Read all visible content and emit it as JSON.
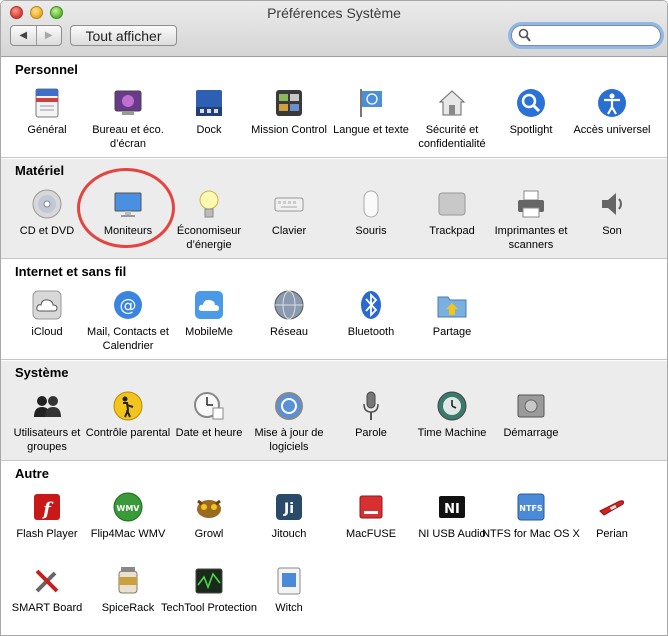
{
  "window": {
    "title": "Préférences Système"
  },
  "toolbar": {
    "back_label": "◀",
    "forward_label": "▶",
    "show_all_label": "Tout afficher",
    "search_value": "",
    "search_placeholder": ""
  },
  "sections": [
    {
      "title": "Personnel",
      "items": [
        {
          "label": "Général",
          "icon": "general-icon"
        },
        {
          "label": "Bureau et éco. d’écran",
          "icon": "desktop-screensaver-icon"
        },
        {
          "label": "Dock",
          "icon": "dock-icon"
        },
        {
          "label": "Mission Control",
          "icon": "mission-control-icon"
        },
        {
          "label": "Langue et texte",
          "icon": "language-text-icon"
        },
        {
          "label": "Sécurité et confidentialité",
          "icon": "security-icon"
        },
        {
          "label": "Spotlight",
          "icon": "spotlight-icon"
        },
        {
          "label": "Accès universel",
          "icon": "universal-access-icon"
        }
      ]
    },
    {
      "title": "Matériel",
      "items": [
        {
          "label": "CD et DVD",
          "icon": "cd-dvd-icon"
        },
        {
          "label": "Moniteurs",
          "icon": "displays-icon"
        },
        {
          "label": "Économiseur d’énergie",
          "icon": "energy-saver-icon"
        },
        {
          "label": "Clavier",
          "icon": "keyboard-icon"
        },
        {
          "label": "Souris",
          "icon": "mouse-icon"
        },
        {
          "label": "Trackpad",
          "icon": "trackpad-icon"
        },
        {
          "label": "Imprimantes et scanners",
          "icon": "printer-icon"
        },
        {
          "label": "Son",
          "icon": "sound-icon"
        }
      ]
    },
    {
      "title": "Internet et sans fil",
      "items": [
        {
          "label": "iCloud",
          "icon": "icloud-icon"
        },
        {
          "label": "Mail, Contacts et Calendrier",
          "icon": "mail-contacts-icon"
        },
        {
          "label": "MobileMe",
          "icon": "mobileme-icon"
        },
        {
          "label": "Réseau",
          "icon": "network-icon"
        },
        {
          "label": "Bluetooth",
          "icon": "bluetooth-icon"
        },
        {
          "label": "Partage",
          "icon": "sharing-icon"
        }
      ]
    },
    {
      "title": "Système",
      "items": [
        {
          "label": "Utilisateurs et groupes",
          "icon": "users-groups-icon"
        },
        {
          "label": "Contrôle parental",
          "icon": "parental-controls-icon"
        },
        {
          "label": "Date et heure",
          "icon": "date-time-icon"
        },
        {
          "label": "Mise à jour de logiciels",
          "icon": "software-update-icon"
        },
        {
          "label": "Parole",
          "icon": "speech-icon"
        },
        {
          "label": "Time Machine",
          "icon": "time-machine-icon"
        },
        {
          "label": "Démarrage",
          "icon": "startup-disk-icon"
        }
      ]
    },
    {
      "title": "Autre",
      "items": [
        {
          "label": "Flash Player",
          "icon": "flash-player-icon"
        },
        {
          "label": "Flip4Mac WMV",
          "icon": "flip4mac-icon"
        },
        {
          "label": "Growl",
          "icon": "growl-icon"
        },
        {
          "label": "Jitouch",
          "icon": "jitouch-icon"
        },
        {
          "label": "MacFUSE",
          "icon": "macfuse-icon"
        },
        {
          "label": "NI USB Audio",
          "icon": "ni-usb-audio-icon"
        },
        {
          "label": "NTFS for Mac OS X",
          "icon": "ntfs-icon"
        },
        {
          "label": "Perian",
          "icon": "perian-icon"
        },
        {
          "label": "SMART Board",
          "icon": "smart-board-icon"
        },
        {
          "label": "SpiceRack",
          "icon": "spicerack-icon"
        },
        {
          "label": "TechTool Protection",
          "icon": "techtool-icon"
        },
        {
          "label": "Witch",
          "icon": "witch-icon"
        }
      ]
    }
  ],
  "highlight": {
    "item": "Moniteurs",
    "color": "#e5433d"
  }
}
